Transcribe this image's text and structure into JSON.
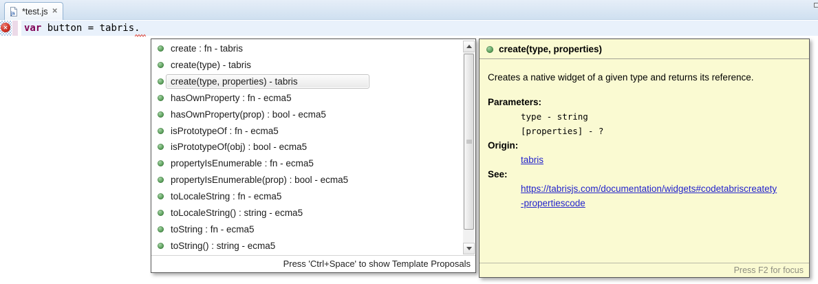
{
  "tab_bar": {
    "tab": {
      "title": "*test.js",
      "close_glyph": "✕",
      "icon": "js-file-icon"
    }
  },
  "editor": {
    "code": {
      "keyword": "var",
      "rest": " button = tabris."
    },
    "error_marker_glyph": "✕"
  },
  "completion_popup": {
    "items": [
      "create : fn - tabris",
      "create(type) - tabris",
      "create(type, properties) - tabris",
      "hasOwnProperty : fn - ecma5",
      "hasOwnProperty(prop) : bool - ecma5",
      "isPrototypeOf : fn - ecma5",
      "isPrototypeOf(obj) : bool - ecma5",
      "propertyIsEnumerable : fn - ecma5",
      "propertyIsEnumerable(prop) : bool - ecma5",
      "toLocaleString : fn - ecma5",
      "toLocaleString() : string - ecma5",
      "toString : fn - ecma5",
      "toString() : string - ecma5"
    ],
    "selected_index": 2,
    "footer": "Press 'Ctrl+Space' to show Template Proposals"
  },
  "doc_panel": {
    "title": "create(type, properties)",
    "description": "Creates a native widget of a given type and returns its reference.",
    "sections": [
      {
        "heading": "Parameters:",
        "lines": [
          {
            "text": "type - string",
            "style": "mono"
          },
          {
            "text": "[properties] - ?",
            "style": "mono"
          }
        ]
      },
      {
        "heading": "Origin:",
        "lines": [
          {
            "text": "tabris",
            "style": "link"
          }
        ]
      },
      {
        "heading": "See:",
        "lines": [
          {
            "text": "https://tabrisjs.com/documentation/widgets#codetabriscreatety",
            "style": "link"
          },
          {
            "text": "-propertiescode",
            "style": "link"
          }
        ]
      }
    ],
    "footer": "Press F2 for focus"
  },
  "colors": {
    "keyword": "#7f0055",
    "link": "#2323cc",
    "doc_background": "#fafad2",
    "current_line": "#e9f1fb",
    "proposal_bullet_green": "#5ba05b",
    "error_red": "#d03327"
  }
}
